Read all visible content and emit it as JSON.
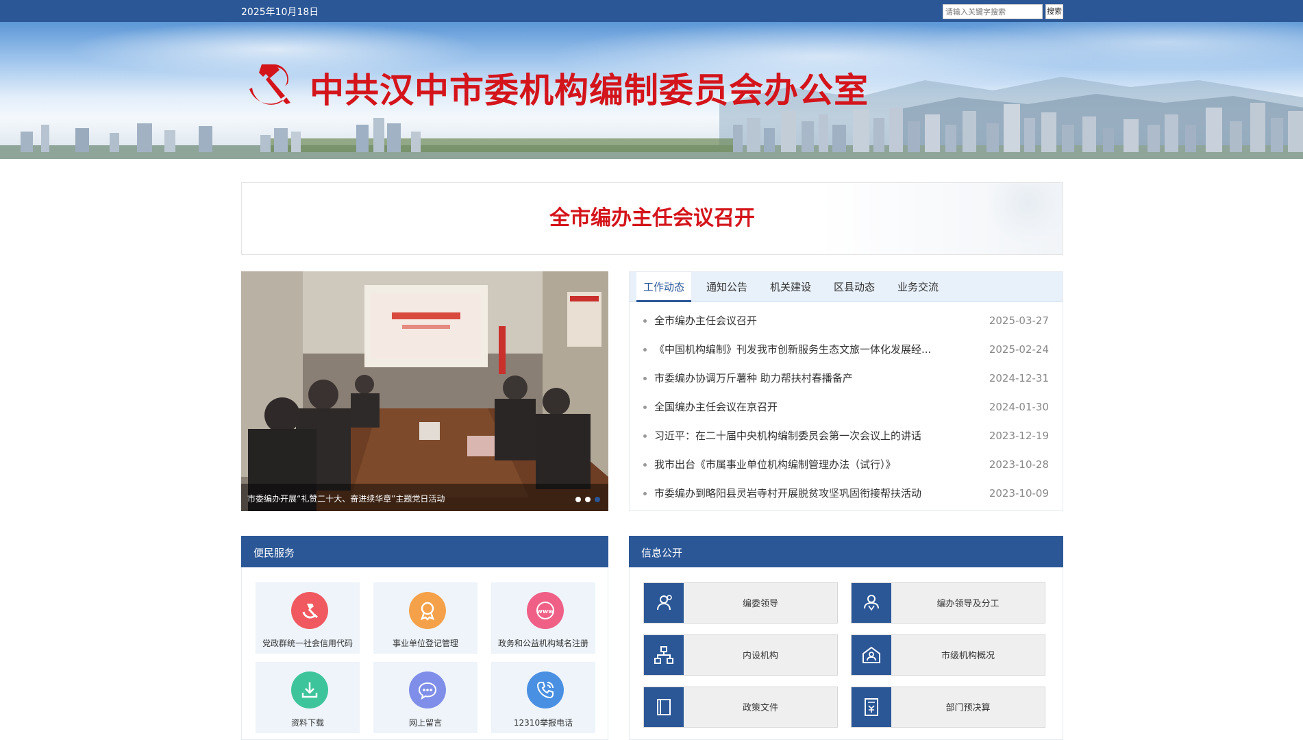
{
  "topbar": {
    "date": "2025年10月18日",
    "search_placeholder": "请输入关键字搜索",
    "search_button": "搜索"
  },
  "header": {
    "site_title": "中共汉中市委机构编制委员会办公室",
    "emblem_icon": "party-emblem-icon",
    "title_color": "#d4141b"
  },
  "headline": {
    "text": "全市编办主任会议召开"
  },
  "slideshow": {
    "caption": "市委编办开展“礼赞二十大、奋进续华章”主题党日活动",
    "dot_count": 3,
    "active_dot": 3
  },
  "news": {
    "tabs": [
      {
        "label": "工作动态",
        "active": true
      },
      {
        "label": "通知公告",
        "active": false
      },
      {
        "label": "机关建设",
        "active": false
      },
      {
        "label": "区县动态",
        "active": false
      },
      {
        "label": "业务交流",
        "active": false
      }
    ],
    "items": [
      {
        "title": "全市编办主任会议召开",
        "date": "2025-03-27"
      },
      {
        "title": "《中国机构编制》刊发我市创新服务生态文旅一体化发展经...",
        "date": "2025-02-24"
      },
      {
        "title": "市委编办协调万斤薯种 助力帮扶村春播备产",
        "date": "2024-12-31"
      },
      {
        "title": "全国编办主任会议在京召开",
        "date": "2024-01-30"
      },
      {
        "title": "习近平：在二十届中央机构编制委员会第一次会议上的讲话",
        "date": "2023-12-19"
      },
      {
        "title": "我市出台《市属事业单位机构编制管理办法（试行）》",
        "date": "2023-10-28"
      },
      {
        "title": "市委编办到略阳县灵岩寺村开展脱贫攻坚巩固衔接帮扶活动",
        "date": "2023-10-09"
      }
    ]
  },
  "service": {
    "title": "便民服务",
    "items": [
      {
        "label": "党政群统一社会信用代码",
        "icon": "party-code-icon",
        "color": "#f0595f"
      },
      {
        "label": "事业单位登记管理",
        "icon": "award-ribbon-icon",
        "color": "#f5a14a"
      },
      {
        "label": "政务和公益机构域名注册",
        "icon": "www-globe-icon",
        "color": "#ef5f86"
      },
      {
        "label": "资料下载",
        "icon": "download-icon",
        "color": "#3ec49b"
      },
      {
        "label": "网上留言",
        "icon": "chat-bubble-icon",
        "color": "#7f8ee8"
      },
      {
        "label": "12310举报电话",
        "icon": "phone-icon",
        "color": "#4a90e2"
      }
    ]
  },
  "info": {
    "title": "信息公开",
    "items": [
      {
        "label": "编委领导",
        "icon": "leaders-icon"
      },
      {
        "label": "编办领导及分工",
        "icon": "leader-division-icon"
      },
      {
        "label": "内设机构",
        "icon": "org-chart-icon"
      },
      {
        "label": "市级机构概况",
        "icon": "building-icon"
      },
      {
        "label": "政策文件",
        "icon": "document-icon"
      },
      {
        "label": "部门预决算",
        "icon": "budget-icon"
      }
    ]
  },
  "colors": {
    "brand_blue": "#2b5797",
    "accent_red": "#d4141b"
  }
}
